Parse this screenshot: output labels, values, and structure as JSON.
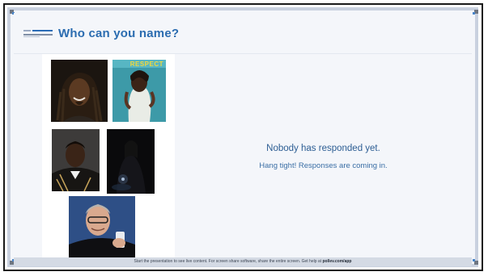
{
  "header": {
    "title": "Who can you name?"
  },
  "empty_state": {
    "title": "Nobody has responded yet.",
    "subtitle": "Hang tight! Responses are coming in."
  },
  "photos": {
    "tile2_text": "RESPECT"
  },
  "footer": {
    "text": "Start the presentation to see live content. For screen share software, share the entire screen. Get help at",
    "link": "pollev.com/app"
  },
  "colors": {
    "accent": "#2b6cb0",
    "text_blue": "#2c5d93",
    "footer_bg": "#d4dae4",
    "slide_bg": "#f4f6fa"
  }
}
